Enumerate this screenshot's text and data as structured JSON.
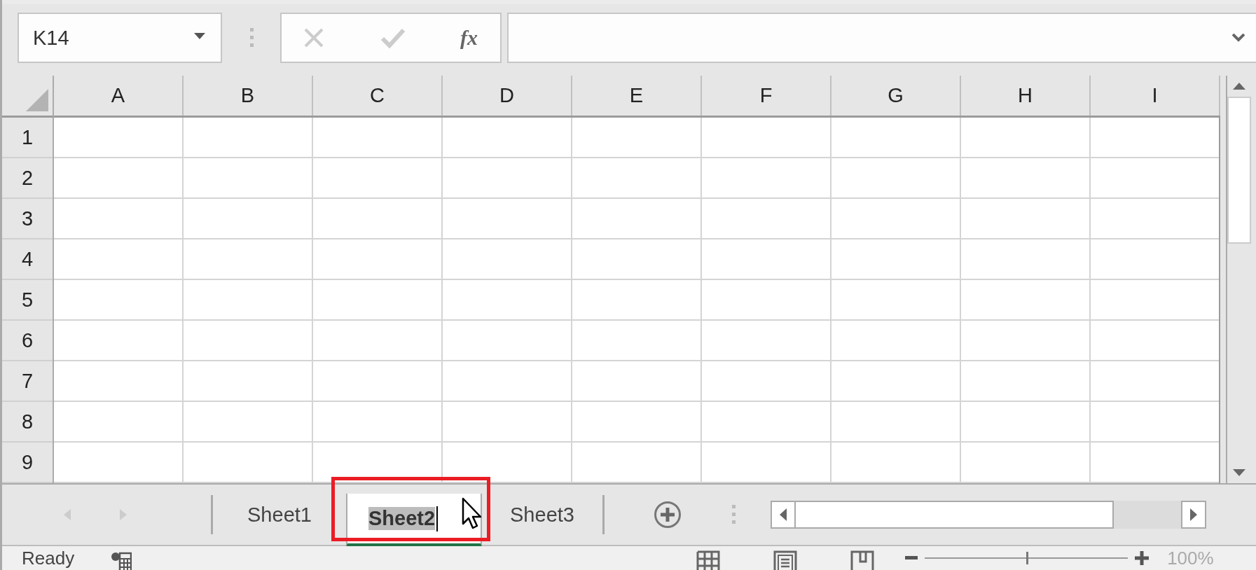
{
  "name_box": {
    "value": "K14"
  },
  "formula_buttons": [
    {
      "kind": "cancel",
      "disabled": true
    },
    {
      "kind": "enter",
      "disabled": true
    },
    {
      "kind": "function",
      "label": "fx",
      "disabled": false
    }
  ],
  "columns": [
    "A",
    "B",
    "C",
    "D",
    "E",
    "F",
    "G",
    "H",
    "I"
  ],
  "rows": [
    "1",
    "2",
    "3",
    "4",
    "5",
    "6",
    "7",
    "8",
    "9"
  ],
  "sheet_tabs": [
    {
      "label": "Sheet1",
      "selected": false,
      "editing": false
    },
    {
      "label": "Sheet2",
      "selected": true,
      "editing": true
    },
    {
      "label": "Sheet3",
      "selected": false,
      "editing": false
    }
  ],
  "highlight": {
    "on": true
  },
  "status_bar": {
    "status": "Ready",
    "zoom": {
      "level": 0.5,
      "value": "100%"
    }
  }
}
